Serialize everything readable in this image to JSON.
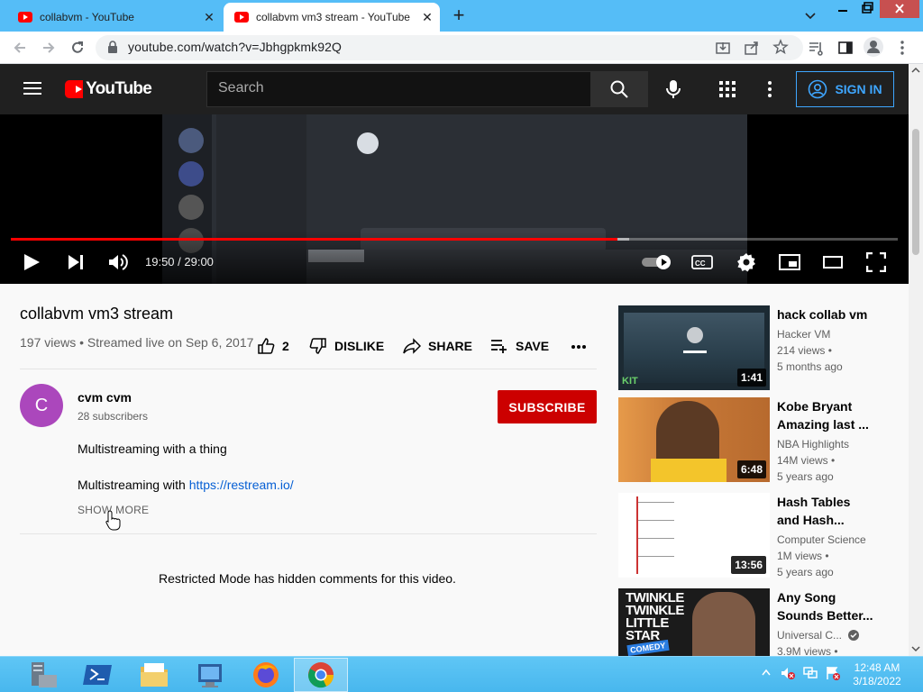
{
  "browser": {
    "tabs": [
      {
        "title": "collabvm - YouTube",
        "active": false
      },
      {
        "title": "collabvm vm3 stream - YouTube",
        "active": true
      }
    ],
    "url": "youtube.com/watch?v=Jbhgpkmk92Q"
  },
  "youtube": {
    "logo_text": "YouTube",
    "search_placeholder": "Search",
    "signin_label": "SIGN IN"
  },
  "player": {
    "time": "19:50 / 29:00",
    "progress_fraction": 0.684
  },
  "video": {
    "title": "collabvm vm3 stream",
    "meta": "197 views • Streamed live on Sep 6, 2017",
    "likes": "2",
    "dislike_label": "DISLIKE",
    "share_label": "SHARE",
    "save_label": "SAVE"
  },
  "channel": {
    "avatar_letter": "C",
    "name": "cvm cvm",
    "subscribers": "28 subscribers",
    "subscribe_label": "SUBSCRIBE"
  },
  "description": {
    "line1": "Multistreaming with a thing",
    "line2_prefix": "Multistreaming with ",
    "line2_link": "https://restream.io/",
    "show_more": "SHOW MORE"
  },
  "comments": {
    "restricted_notice": "Restricted Mode has hidden comments for this video."
  },
  "recommendations": [
    {
      "title": "hack collab vm",
      "title2": "",
      "channel": "Hacker VM",
      "views": "214 views •",
      "age": "5 months ago",
      "duration": "1:41"
    },
    {
      "title": "Kobe Bryant",
      "title2": "Amazing last ...",
      "channel": "NBA Highlights",
      "views": "14M views •",
      "age": "5 years ago",
      "duration": "6:48"
    },
    {
      "title": "Hash Tables",
      "title2": "and Hash...",
      "channel": "Computer Science",
      "views": "1M views •",
      "age": "5 years ago",
      "duration": "13:56"
    },
    {
      "title": "Any Song",
      "title2": "Sounds Better...",
      "channel": "Universal C...",
      "views": "3.9M views •",
      "age": "",
      "duration": ""
    }
  ],
  "thumb_text": {
    "kobe": "",
    "twinkle": "TWINKLE TWINKLE LITTLE STAR",
    "comedy": "COMEDY",
    "kit": "KIT"
  },
  "taskbar": {
    "time": "12:48 AM",
    "date": "3/18/2022"
  },
  "colors": {
    "youtube_red": "#ff0000",
    "subscribe_red": "#cc0000",
    "link_blue": "#065fd4",
    "signin_blue": "#3ea6ff",
    "tab_strip": "#55bdf7"
  }
}
